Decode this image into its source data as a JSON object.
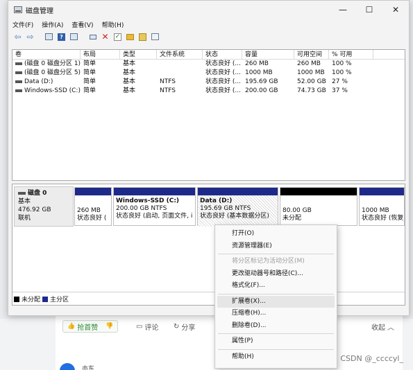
{
  "window": {
    "title": "磁盘管理",
    "minimize": "—",
    "maximize": "☐",
    "close": "✕"
  },
  "menubar": [
    "文件(F)",
    "操作(A)",
    "查看(V)",
    "帮助(H)"
  ],
  "volume_list": {
    "columns": [
      "卷",
      "布局",
      "类型",
      "文件系统",
      "状态",
      "容量",
      "可用空间",
      "% 可用"
    ],
    "rows": [
      [
        "(磁盘 0 磁盘分区 1)",
        "简单",
        "基本",
        "",
        "状态良好 (...",
        "260 MB",
        "260 MB",
        "100 %"
      ],
      [
        "(磁盘 0 磁盘分区 5)",
        "简单",
        "基本",
        "",
        "状态良好 (...",
        "1000 MB",
        "1000 MB",
        "100 %"
      ],
      [
        "Data (D:)",
        "简单",
        "基本",
        "NTFS",
        "状态良好 (...",
        "195.69 GB",
        "52.00 GB",
        "27 %"
      ],
      [
        "Windows-SSD (C:)",
        "简单",
        "基本",
        "NTFS",
        "状态良好 (...",
        "200.00 GB",
        "74.73 GB",
        "37 %"
      ]
    ]
  },
  "disk": {
    "name": "磁盘 0",
    "type": "基本",
    "size": "476.92 GB",
    "status": "联机",
    "partitions": [
      {
        "label": "",
        "size": "260 MB",
        "status": "状态良好 ("
      },
      {
        "label": "Windows-SSD  (C:)",
        "size": "200.00 GB NTFS",
        "status": "状态良好 (启动, 页面文件, i"
      },
      {
        "label": "Data  (D:)",
        "size": "195.69 GB NTFS",
        "status": "状态良好 (基本数据分区)"
      },
      {
        "label": "",
        "size": "80.00 GB",
        "status": "未分配"
      },
      {
        "label": "",
        "size": "1000 MB",
        "status": "状态良好 (恢复"
      }
    ]
  },
  "legend": {
    "unallocated": "未分配",
    "primary": "主分区"
  },
  "context_menu": {
    "open": "打开(O)",
    "explorer": "资源管理器(E)",
    "mark_active": "将分区标记为活动分区(M)",
    "change_letter": "更改驱动器号和路径(C)...",
    "format": "格式化(F)...",
    "extend": "扩展卷(X)...",
    "shrink": "压缩卷(H)...",
    "delete": "删除卷(D)...",
    "properties": "属性(P)",
    "help": "帮助(H)"
  },
  "background": {
    "praise": "抢首赞",
    "comment": "评论",
    "share": "分享",
    "fold": "收起",
    "author": "亦东",
    "watermark": "CSDN @_ccccyl_"
  },
  "colors": {
    "primary_partition": "#1e2a8a",
    "unallocated": "#000000",
    "menu_hover": "#e6e6e6"
  }
}
